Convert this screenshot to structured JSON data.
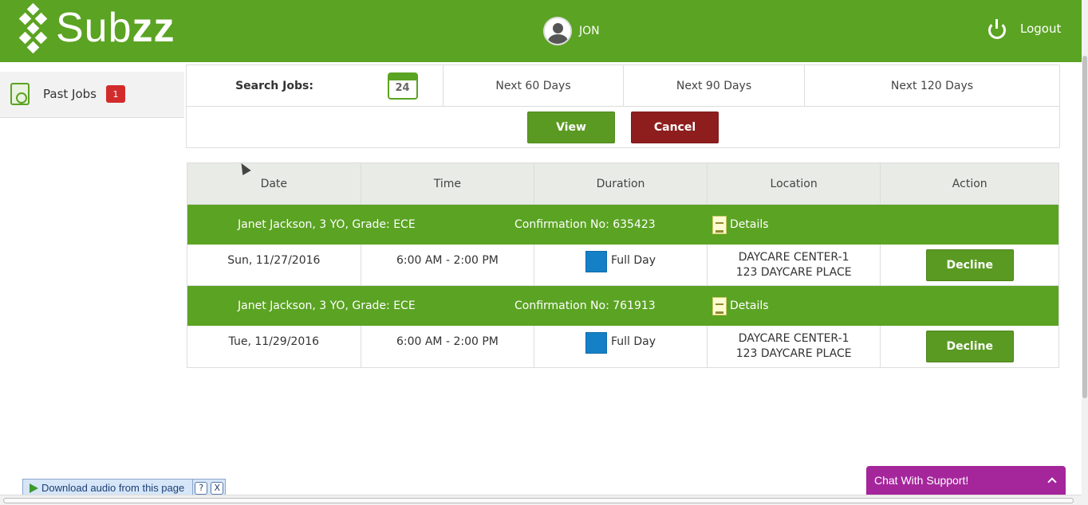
{
  "header": {
    "logo_text_regular": "Sub",
    "logo_text_bold": "zz",
    "user_name": "JON",
    "logout_label": "Logout"
  },
  "sidebar": {
    "items": [
      {
        "label": "Past Jobs",
        "badge": "1",
        "icon": "disc-icon"
      }
    ]
  },
  "search": {
    "label": "Search Jobs:",
    "calendar_day": "24",
    "ranges": [
      "Next 60 Days",
      "Next 90 Days",
      "Next 120 Days"
    ],
    "view_label": "View",
    "cancel_label": "Cancel"
  },
  "jobs_table": {
    "columns": [
      "Date",
      "Time",
      "Duration",
      "Location",
      "Action"
    ],
    "jobs": [
      {
        "person": "Janet Jackson, 3 YO, Grade: ECE",
        "confirmation": "Confirmation No: 635423",
        "details_label": "Details",
        "date": "Sun, 11/27/2016",
        "time": "6:00 AM - 2:00 PM",
        "duration": "Full Day",
        "location_name": "DAYCARE CENTER-1",
        "location_address": "123 DAYCARE PLACE",
        "action_label": "Decline"
      },
      {
        "person": "Janet Jackson, 3 YO, Grade: ECE",
        "confirmation": "Confirmation No: 761913",
        "details_label": "Details",
        "date": "Tue, 11/29/2016",
        "time": "6:00 AM - 2:00 PM",
        "duration": "Full Day",
        "location_name": "DAYCARE CENTER-1",
        "location_address": "123 DAYCARE PLACE",
        "action_label": "Decline"
      }
    ]
  },
  "audio_toolbar": {
    "download_label": "Download audio from this page",
    "help_label": "?",
    "close_label": "X"
  },
  "chat": {
    "label": "Chat With Support!"
  },
  "colors": {
    "brand_green": "#5ba323",
    "cancel_red": "#8e1e1e",
    "badge_red": "#d22b2b",
    "duration_blue": "#1580c6",
    "chat_purple": "#a5269b"
  }
}
